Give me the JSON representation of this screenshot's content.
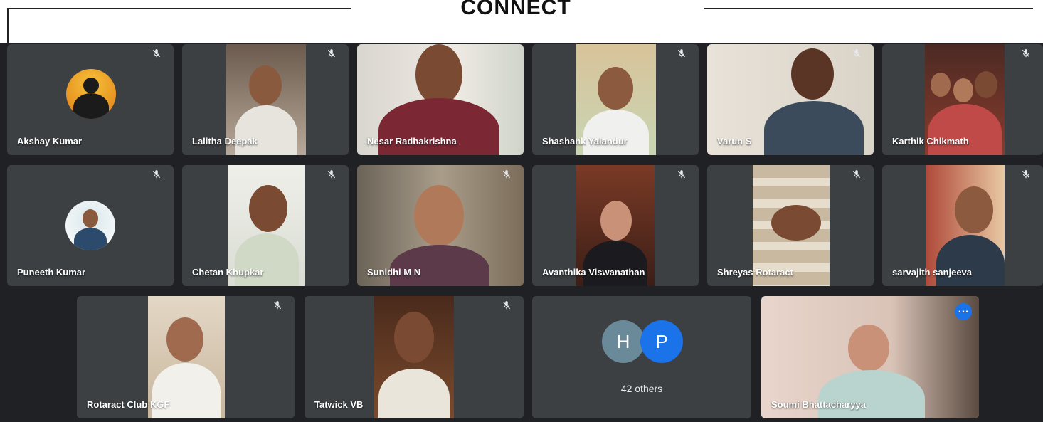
{
  "header": {
    "title": "CONNECT"
  },
  "participants": [
    {
      "name": "Akshay Kumar"
    },
    {
      "name": "Lalitha Deepak"
    },
    {
      "name": "Nesar Radhakrishna"
    },
    {
      "name": "Shashank Yalandur"
    },
    {
      "name": "Varun S"
    },
    {
      "name": "Karthik Chikmath"
    },
    {
      "name": "Puneeth Kumar"
    },
    {
      "name": "Chetan Khupkar"
    },
    {
      "name": "Sunidhi M N"
    },
    {
      "name": "Avanthika Viswanathan"
    },
    {
      "name": "Shreyas Rotaract"
    },
    {
      "name": "sarvajith sanjeeva"
    },
    {
      "name": "Rotaract Club KGF"
    },
    {
      "name": "Tatwick VB"
    },
    {
      "name": "Soumi Bhattacharyya"
    }
  ],
  "others": {
    "initials": [
      "H",
      "P"
    ],
    "label": "42 others"
  },
  "icons": {
    "mic": "mic-off-icon",
    "more": "more-options-icon"
  },
  "colors": {
    "background": "#202124",
    "tile": "#3c4043",
    "accent": "#1a73e8",
    "active_border": "#8ab4f8"
  }
}
